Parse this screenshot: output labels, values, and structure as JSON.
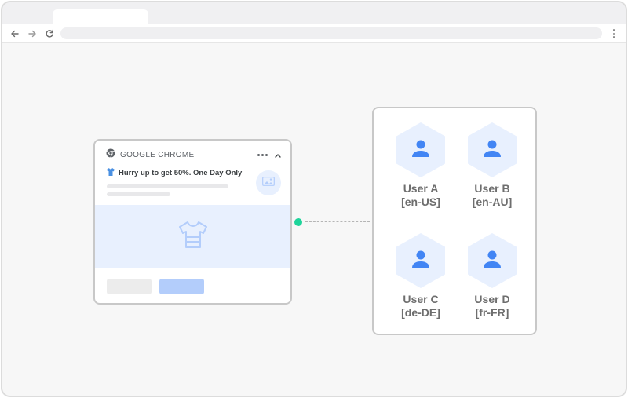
{
  "browser": {
    "tab_title": "",
    "address": ""
  },
  "notification": {
    "app_name": "GOOGLE CHROME",
    "title": "Hurry up to get 50%. One Day Only"
  },
  "users": [
    {
      "name": "User A",
      "locale": "[en-US]"
    },
    {
      "name": "User B",
      "locale": "[en-AU]"
    },
    {
      "name": "User C",
      "locale": "[de-DE]"
    },
    {
      "name": "User D",
      "locale": "[fr-FR]"
    }
  ],
  "colors": {
    "accent_blue": "#4285f4",
    "hex_bg": "#e8f0fe",
    "connector_green": "#1ed49a",
    "button_blue": "#b3cdfb"
  },
  "icons": [
    "back-arrow-icon",
    "forward-arrow-icon",
    "reload-icon",
    "browser-menu-icon",
    "chrome-logo-icon",
    "more-dots-icon",
    "collapse-chevron-icon",
    "tshirt-icon",
    "image-icon",
    "user-icon"
  ]
}
